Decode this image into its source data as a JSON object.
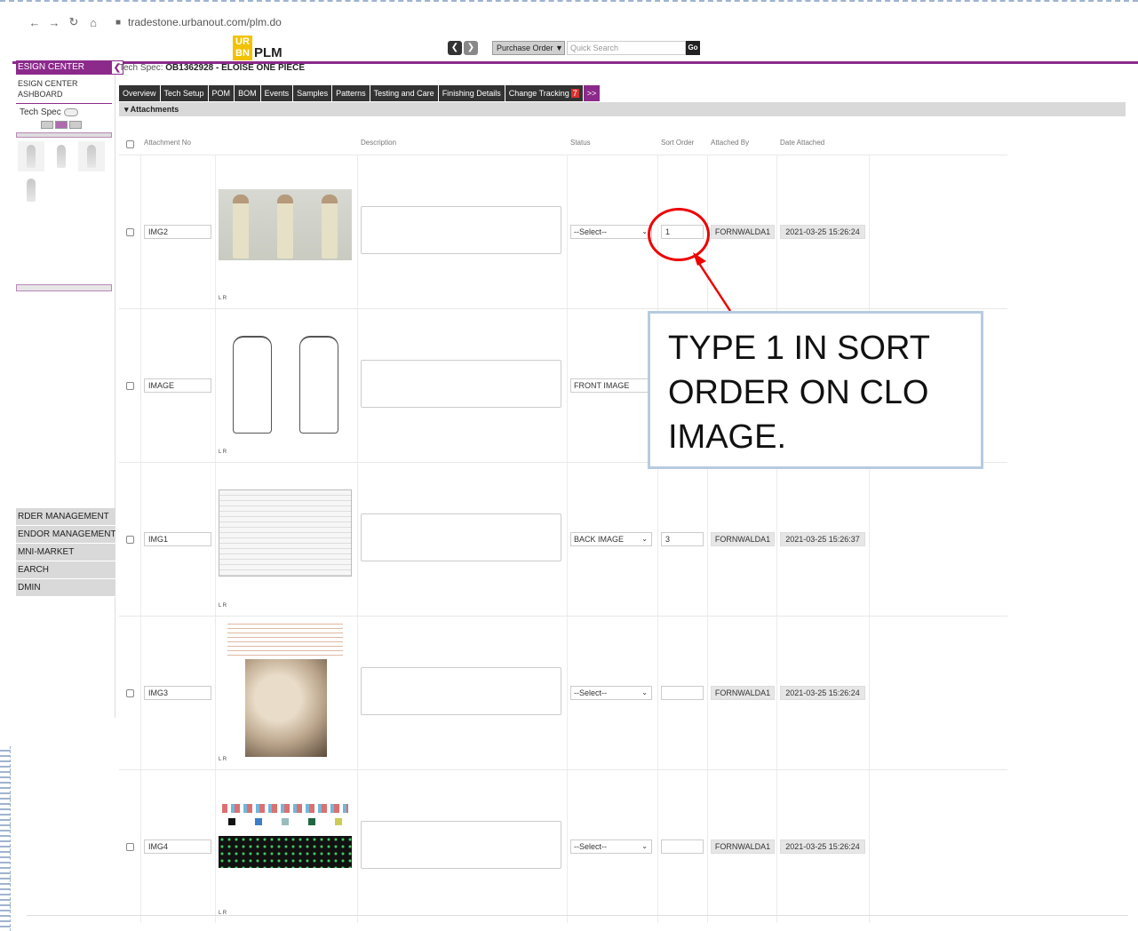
{
  "browser": {
    "back": "←",
    "forward": "→",
    "reload": "↻",
    "home": "⌂",
    "url": "tradestone.urbanout.com/plm.do"
  },
  "header": {
    "logo_mark": "UR BN",
    "logo_text": "PLM",
    "prev": "❮",
    "next": "❯",
    "po_select": "Purchase Order ▼",
    "quick_search_placeholder": "Quick Search",
    "go": "Go"
  },
  "sidebar": {
    "title": "ESIGN CENTER",
    "collapse": "❮",
    "dashboard": "ESIGN CENTER\nASHBOARD",
    "dashboard_line1": "ESIGN CENTER",
    "dashboard_line2": "ASHBOARD",
    "tech_spec": "Tech Spec",
    "menu": [
      "RDER MANAGEMENT",
      "ENDOR MANAGEMENT",
      "MNI-MARKET",
      "EARCH",
      "DMIN"
    ]
  },
  "main": {
    "tech_spec_label": "Tech Spec:",
    "tech_spec_value": "OB1362928 - ELOISE ONE PIECE",
    "tabs": [
      "Overview",
      "Tech Setup",
      "POM",
      "BOM",
      "Events",
      "Samples",
      "Patterns",
      "Testing and Care",
      "Finishing Details",
      "Change Tracking"
    ],
    "change_tracking_badge": "7",
    "more_tab": ">>",
    "section": "▾  Attachments",
    "columns": {
      "attachment_no": "Attachment No",
      "description": "Description",
      "status": "Status",
      "sort_order": "Sort Order",
      "attached_by": "Attached By",
      "date_attached": "Date Attached"
    },
    "lr": "L R",
    "rows": [
      {
        "attachment_no": "IMG2",
        "status": "--Select--",
        "sort_order": "1",
        "attached_by": "FORNWALDA1",
        "date": "2021-03-25 15:26:24",
        "image": "3d-renders"
      },
      {
        "attachment_no": "IMAGE",
        "status": "FRONT IMAGE",
        "sort_order": "",
        "attached_by": "",
        "date": "",
        "image": "flat-sketch"
      },
      {
        "attachment_no": "IMG1",
        "status": "BACK IMAGE",
        "sort_order": "3",
        "attached_by": "FORNWALDA1",
        "date": "2021-03-25 15:26:37",
        "image": "spec-sheet"
      },
      {
        "attachment_no": "IMG3",
        "status": "--Select--",
        "sort_order": "",
        "attached_by": "FORNWALDA1",
        "date": "2021-03-25 15:26:24",
        "image": "fabric-photo"
      },
      {
        "attachment_no": "IMG4",
        "status": "--Select--",
        "sort_order": "",
        "attached_by": "FORNWALDA1",
        "date": "2021-03-25 15:26:24",
        "image": "swatch-board"
      }
    ]
  },
  "annotation": {
    "text": "TYPE 1 IN SORT ORDER ON CLO IMAGE.",
    "color": "#e00000"
  },
  "colors": {
    "brand": "#8b2a8b",
    "logo": "#f2c200",
    "badge": "#d93030"
  }
}
